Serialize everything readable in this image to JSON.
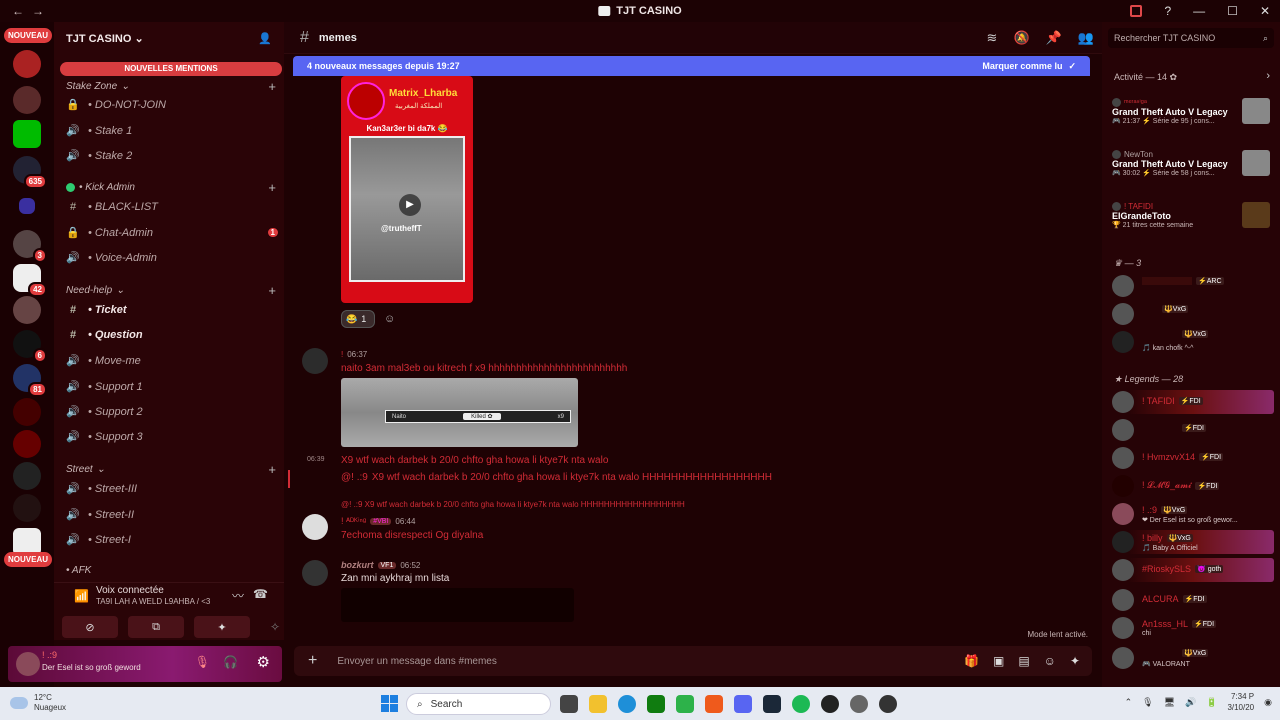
{
  "titlebar": {
    "title": "TJT CASINO",
    "back": "←",
    "forward": "→"
  },
  "rail": {
    "nouveau_top": "NOUVEAU",
    "nouveau_bottom": "NOUVEAU",
    "badges": [
      "635",
      "3",
      "42",
      "6",
      "81"
    ]
  },
  "sidebar": {
    "server_name": "TJT CASINO ⌄",
    "mentions": "NOUVELLES MENTIONS",
    "categories": {
      "stake_zone": "Stake Zone",
      "kick_admin": "• Kick Admin",
      "need_help": "Need-help",
      "street": "Street",
      "afk": "• AFK"
    },
    "channels": {
      "do_not_join": "• DO-NOT-JOIN",
      "stake1": "• Stake 1",
      "stake2": "• Stake 2",
      "blacklist": "• BLACK-LIST",
      "chat_admin": "• Chat-Admin",
      "chat_admin_badge": "1",
      "voice_admin": "• Voice-Admin",
      "ticket": "• Ticket",
      "question": "• Question",
      "move_me": "• Move-me",
      "support1": "• Support 1",
      "support2": "• Support 2",
      "support3": "• Support 3",
      "street3": "• Street-III",
      "street2": "• Street-II",
      "street1": "• Street-I"
    }
  },
  "voice": {
    "title": "Voix connectée",
    "subtitle": "TA9I LAH A WELD L9AHBA / <3"
  },
  "user": {
    "name": "! .:9",
    "status": "Der Esel ist so groß gewor­d"
  },
  "chat": {
    "channel": "memes",
    "new_bar": "4 nouveaux messages depuis 19:27",
    "mark_read": "Marquer comme lu",
    "meme_title": "Matrix_Lharba",
    "meme_subtitle": "المملكة المغربية",
    "meme_caption": "Kan3ar3er bi da7k 😂",
    "meme_handle": "@trutheffT",
    "reaction_count": "1",
    "msg1_time": "06:37",
    "msg1_text": "naito 3am mal3eb ou kitrech f x9 hhhhhhhhhhhhhhhhhhhhhhhhh",
    "kill_left": "Naito",
    "kill_mid": "Killed ✿",
    "kill_right": "x9",
    "msg2_time": "06:39",
    "msg2_text": "X9 wtf wach darbek b 20/0 chfto gha howa li ktye7k nta walo",
    "msg3_prefix": "@! .:9",
    "msg3_text": "X9 wtf wach darbek b 20/0 chfto gha howa li ktye7k nta walo HHHHHHHHHHHHHHHHHH",
    "reply_text": "@! .:9  X9 wtf wach darbek b 20/0 chfto gha howa li ktye7k nta walo HHHHHHHHHHHHHHHHHH",
    "msg4_user": "! ᴬᴰᴷⁱⁿᵍ",
    "msg4_tag": "#VBI",
    "msg4_time": "06:44",
    "msg4_text": "7echoma disrespecti  Og diyalna",
    "msg5_user": "bozkurt",
    "msg5_tag": "VF1",
    "msg5_time": "06:52",
    "msg5_text": "Zan mni aykhraj mn lista",
    "slow_mode": "Mode lent activé.",
    "input_placeholder": "Envoyer un message dans #memes"
  },
  "right": {
    "search_placeholder": "Rechercher TJT CASINO",
    "activity_header": "Activité — 14 ✿",
    "activities": [
      {
        "name": "ᵐᵉʳᵃⁿⁱᵍᵃ",
        "game": "Grand Theft Auto V Legacy",
        "detail": "🎮 21:37  ⚡ Série de 95 j cons..."
      },
      {
        "name": "NewTon",
        "game": "Grand Theft Auto V Legacy",
        "detail": "🎮 30:02  ⚡ Série de 58 j cons..."
      },
      {
        "name": "! TAFIDI",
        "game": "ElGrandeToto",
        "detail": "🏆 21 titres cette semaine"
      }
    ],
    "group1": "♛ — 3",
    "group1_members": [
      {
        "name": "",
        "tag": "⚡ARC",
        "status": ""
      },
      {
        "name": "",
        "tag": "🔱VxG",
        "status": ""
      },
      {
        "name": "",
        "tag": "🔱VxG",
        "status": "🎵 kan chofk ^-^"
      }
    ],
    "group2": "★ Legends — 28",
    "group2_members": [
      {
        "name": "! TAFIDI",
        "tag": "⚡FDI",
        "status": ""
      },
      {
        "name": "",
        "tag": "⚡FDI",
        "status": ""
      },
      {
        "name": "! HvmzvvX14",
        "tag": "⚡FDI",
        "status": ""
      },
      {
        "name": "! 𝓛𝓜𝓖_𝓪𝓶𝓲",
        "tag": "⚡FDI",
        "status": ""
      },
      {
        "name": "! .:9",
        "tag": "🔱VxG",
        "status": "❤ Der Esel ist so groß gewor..."
      },
      {
        "name": "! billy",
        "tag": "🔱VxG",
        "status": "🎵 Baby A Officiel"
      },
      {
        "name": "#RioskySLS",
        "tag": "😈 goth",
        "status": ""
      },
      {
        "name": "ALCURA",
        "tag": "⚡FDI",
        "status": ""
      },
      {
        "name": "An1sss_HL",
        "tag": "⚡FDI",
        "status": "chi"
      },
      {
        "name": "",
        "tag": "🔱VxG",
        "status": "🎮 VALORANT"
      }
    ]
  },
  "taskbar": {
    "temp": "12°C",
    "weather": "Nuageux",
    "search": "Search",
    "time": "7:34 P",
    "date": "3/10/20"
  }
}
